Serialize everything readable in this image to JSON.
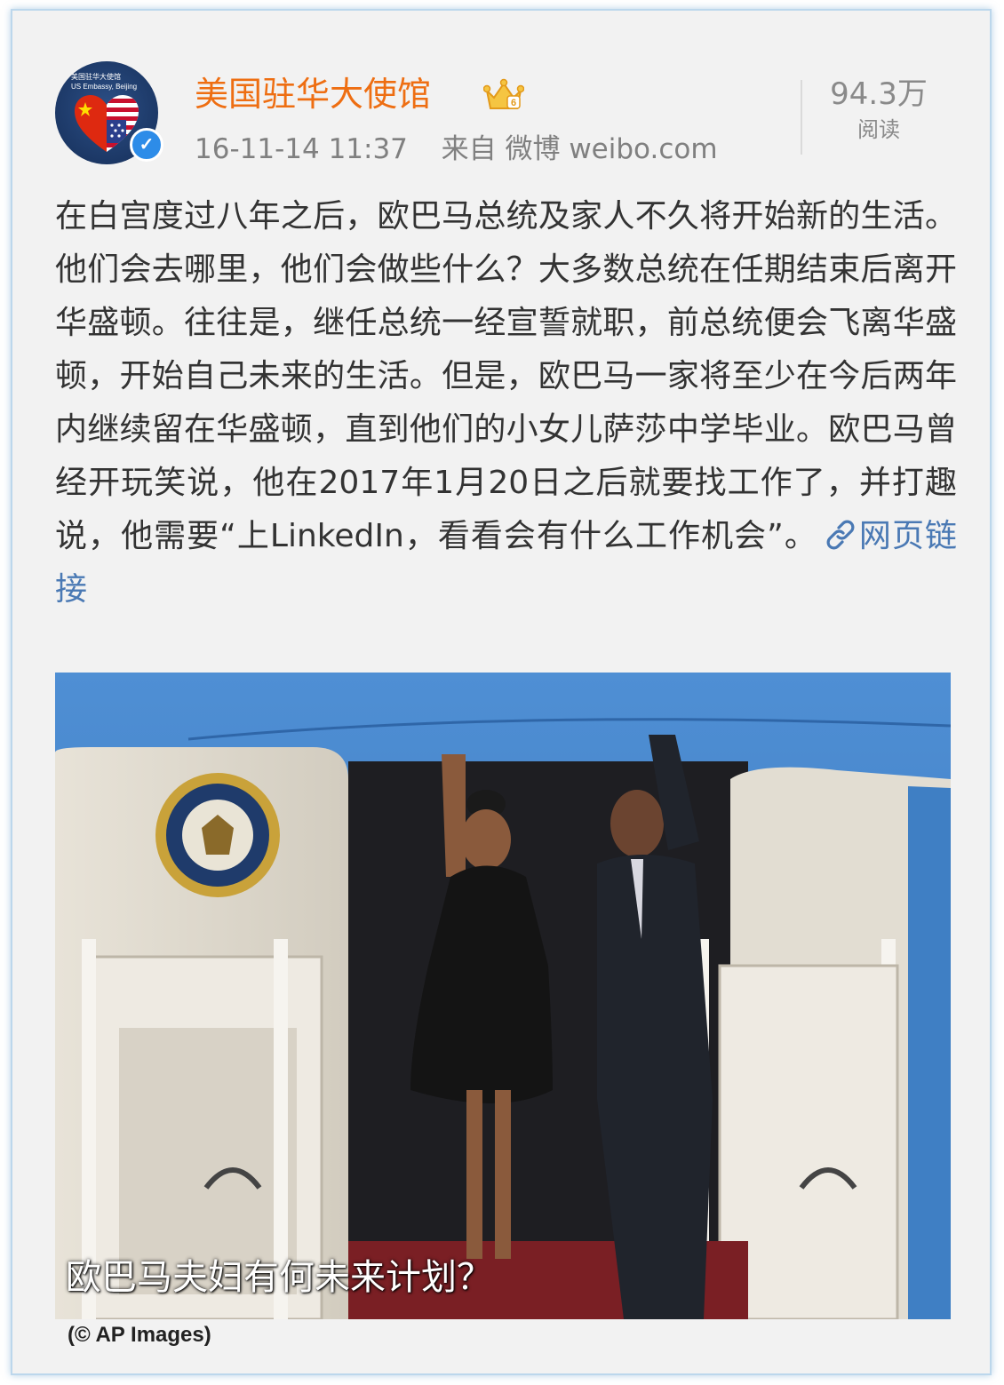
{
  "post": {
    "account_name": "美国驻华大使馆",
    "avatar_text_line1": "美国驻华大使馆",
    "avatar_text_line2": "US Embassy, Beijing",
    "timestamp": "16-11-14 11:37",
    "source": "来自 微博 weibo.com",
    "read_count": "94.3万",
    "read_label": "阅读",
    "body_text": "在白宫度过八年之后，欧巴马总统及家人不久将开始新的生活。他们会去哪里，他们会做些什么？大多数总统在任期结束后离开华盛顿。往往是，继任总统一经宣誓就职，前总统便会飞离华盛顿，开始自己未来的生活。但是，欧巴马一家将至少在今后两年内继续留在华盛顿，直到他们的小女儿萨莎中学毕业。欧巴马曾经开玩笑说，他在2017年1月20日之后就要找工作了，并打趣说，他需要“上LinkedIn，看看会有什么工作机会”。",
    "link_label": "网页链接"
  },
  "image": {
    "caption": "欧巴马夫妇有何未来计划？",
    "credit": "(© AP Images)"
  },
  "colors": {
    "account_name": "#ee6e12",
    "link": "#4a79b4",
    "verified_badge": "#2d8ce8",
    "frame_border": "#bcd7ec"
  },
  "icons": [
    "avatar-flag-heart-icon",
    "verified-badge-icon",
    "vip-crown-icon",
    "link-icon",
    "presidential-seal-icon"
  ]
}
